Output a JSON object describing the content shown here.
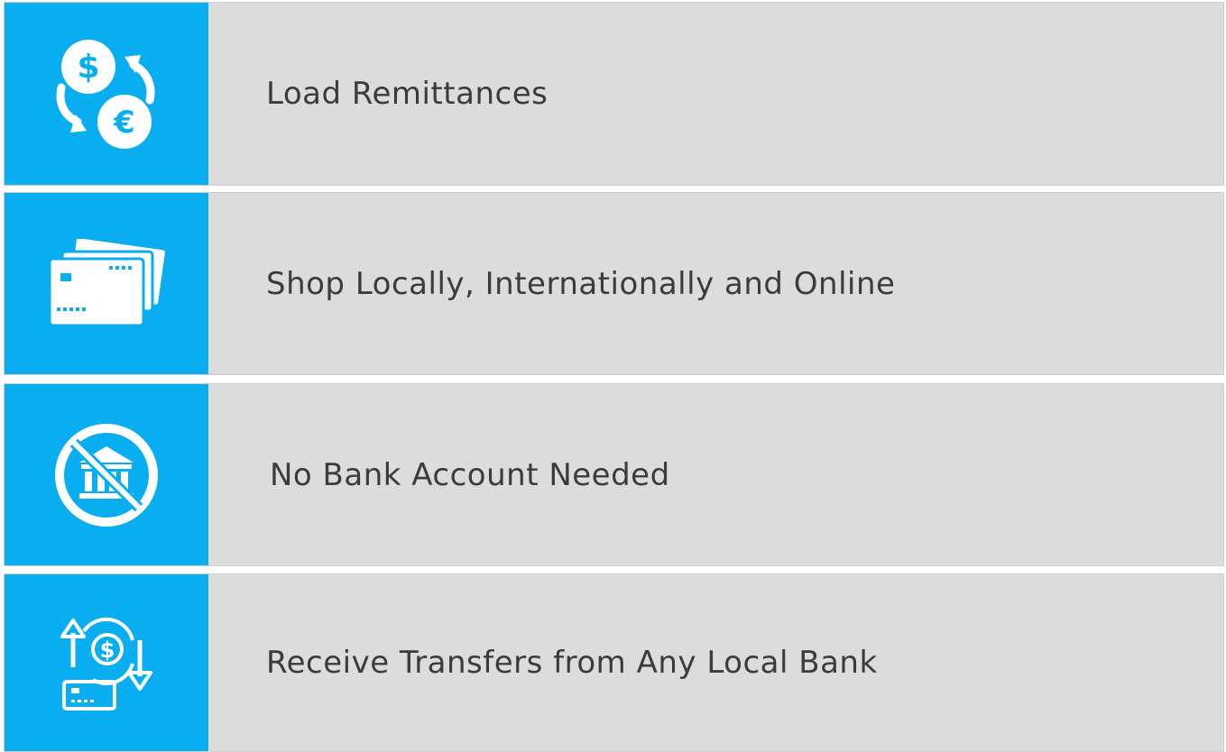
{
  "colors": {
    "tile": "#08aef0",
    "row_background": "#dcdcdc",
    "text": "#3b3b3b",
    "icon": "#ffffff"
  },
  "features": [
    {
      "icon": "currency-exchange-icon",
      "label": "Load Remittances"
    },
    {
      "icon": "credit-cards-icon",
      "label": "Shop Locally, Internationally and Online"
    },
    {
      "icon": "no-bank-icon",
      "label": "No Bank Account Needed"
    },
    {
      "icon": "transfer-card-icon",
      "label": "Receive Transfers from Any Local Bank"
    }
  ]
}
